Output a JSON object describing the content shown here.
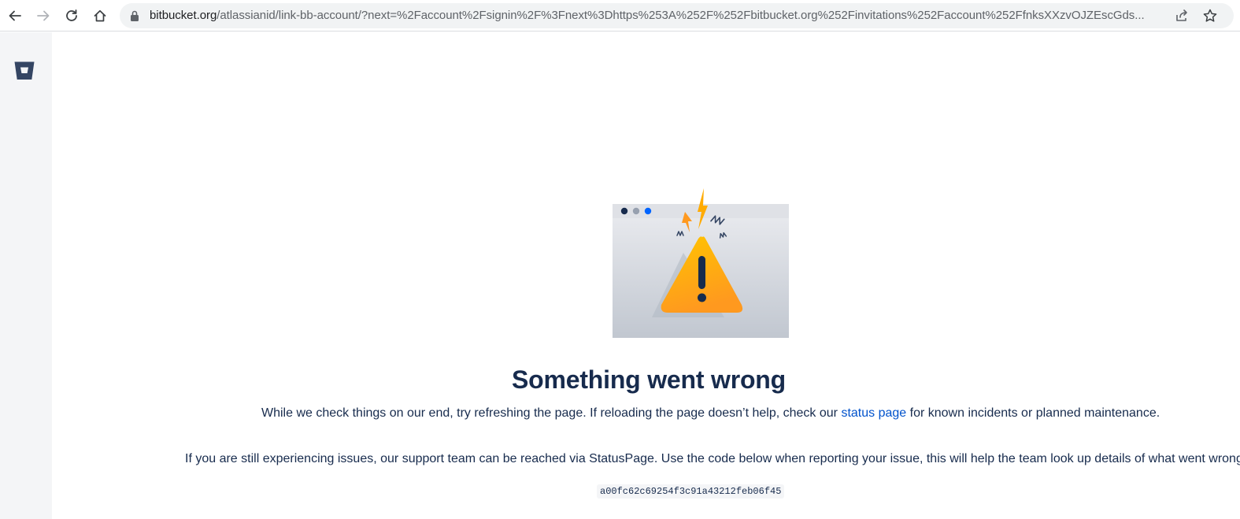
{
  "browser": {
    "url_host": "bitbucket.org",
    "url_path": "/atlassianid/link-bb-account/?next=%2Faccount%2Fsignin%2F%3Fnext%3Dhttps%253A%252F%252Fbitbucket.org%252Finvitations%252Faccount%252FfnksXXzvOJZEscGds...",
    "icons": [
      "back-icon",
      "forward-icon",
      "reload-icon",
      "home-icon",
      "lock-icon",
      "share-icon",
      "star-icon"
    ]
  },
  "sidebar": {
    "logo_icon": "bitbucket-logo-icon"
  },
  "error": {
    "title": "Something went wrong",
    "para1_before": "While we check things on our end, try refreshing the page. If reloading the page doesn’t help, check our ",
    "status_link": "status page",
    "para1_after": " for known incidents or planned maintenance.",
    "para2": "If you are still experiencing issues, our support team can be reached via StatusPage. Use the code below when reporting your issue, this will help the team look up details of what went wrong:",
    "code": "a00fc62c69254f3c91a43212feb06f45"
  },
  "colors": {
    "text": "#172b4d",
    "link": "#0052cc",
    "sidebar_bg": "#f4f5f7",
    "warning": "#ffab00"
  }
}
